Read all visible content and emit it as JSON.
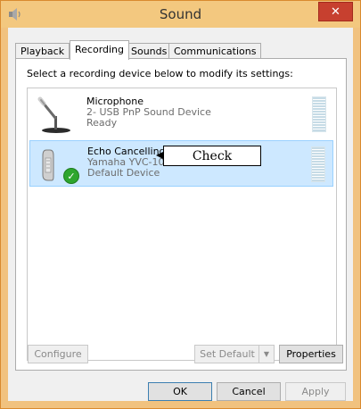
{
  "window": {
    "title": "Sound",
    "close_glyph": "✕"
  },
  "tabs": [
    {
      "label": "Playback"
    },
    {
      "label": "Recording"
    },
    {
      "label": "Sounds"
    },
    {
      "label": "Communications"
    }
  ],
  "active_tab": "Recording",
  "instruction": "Select a recording device below to modify its settings:",
  "devices": [
    {
      "name": "Microphone",
      "description": "2- USB PnP Sound Device",
      "status": "Ready",
      "icon": "microphone-icon",
      "selected": false
    },
    {
      "name": "Echo Cancelling Speakerphone",
      "description": "Yamaha YVC-1000MS",
      "status": "Default Device",
      "icon": "speakerphone-icon",
      "selected": true,
      "badge": "default-check-icon",
      "badge_glyph": "✓"
    }
  ],
  "callout": {
    "text": "Check"
  },
  "buttons": {
    "configure": "Configure",
    "set_default": "Set Default",
    "set_default_arrow": "▼",
    "properties": "Properties",
    "ok": "OK",
    "cancel": "Cancel",
    "apply": "Apply"
  },
  "colors": {
    "title_bar": "#f3c87f",
    "close_button": "#c7402f",
    "selection": "#cde8ff",
    "check_badge": "#2ea62e"
  }
}
